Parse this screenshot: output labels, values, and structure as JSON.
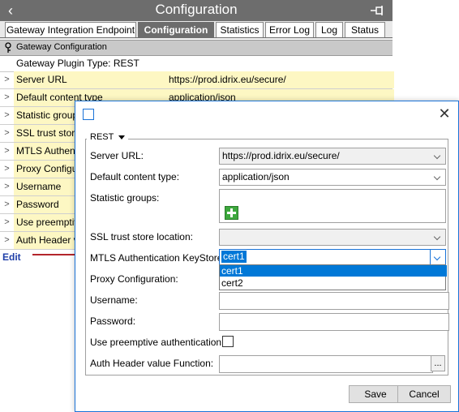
{
  "app": {
    "title": "Configuration"
  },
  "tabs": [
    {
      "label": "Gateway Integration Endpoint",
      "active": false
    },
    {
      "label": "Configuration",
      "active": true
    },
    {
      "label": "Statistics",
      "active": false
    },
    {
      "label": "Error Log",
      "active": false
    },
    {
      "label": "Log",
      "active": false
    },
    {
      "label": "Status",
      "active": false
    }
  ],
  "section": {
    "title": "Gateway Configuration",
    "plugin_type": "Gateway Plugin Type: REST"
  },
  "properties": [
    {
      "name": "Server URL",
      "value": "https://prod.idrix.eu/secure/"
    },
    {
      "name": "Default content type",
      "value": "application/json"
    },
    {
      "name": "Statistic groups",
      "value": ""
    },
    {
      "name": "SSL trust store",
      "value": ""
    },
    {
      "name": "MTLS Authenti",
      "value": ""
    },
    {
      "name": "Proxy Configur",
      "value": ""
    },
    {
      "name": "Username",
      "value": ""
    },
    {
      "name": "Password",
      "value": ""
    },
    {
      "name": "Use preemptive",
      "value": ""
    },
    {
      "name": "Auth Header va",
      "value": ""
    }
  ],
  "edit_label": "Edit",
  "dialog": {
    "group_label": "REST",
    "fields": {
      "server_url": {
        "label": "Server URL:",
        "value": "https://prod.idrix.eu/secure/"
      },
      "content_type": {
        "label": "Default content type:",
        "value": "application/json"
      },
      "stat_groups": {
        "label": "Statistic groups:"
      },
      "ssl_store": {
        "label": "SSL trust store location:",
        "value": ""
      },
      "mtls": {
        "label": "MTLS Authentication KeyStore:",
        "value": "cert1",
        "options": [
          "cert1",
          "cert2"
        ]
      },
      "proxy": {
        "label": "Proxy Configuration:"
      },
      "username": {
        "label": "Username:",
        "value": ""
      },
      "password": {
        "label": "Password:",
        "value": ""
      },
      "preemptive": {
        "label": "Use preemptive authentication:",
        "checked": false
      },
      "auth_header": {
        "label": "Auth Header value Function:",
        "value": "",
        "browse": "..."
      }
    },
    "save_label": "Save",
    "cancel_label": "Cancel"
  },
  "colors": {
    "titlebar": "#6d6d6d",
    "row_fill": "#fdf7c3",
    "accent": "#1a73d8",
    "selection": "#0078d7",
    "arrow": "#b3262b"
  }
}
